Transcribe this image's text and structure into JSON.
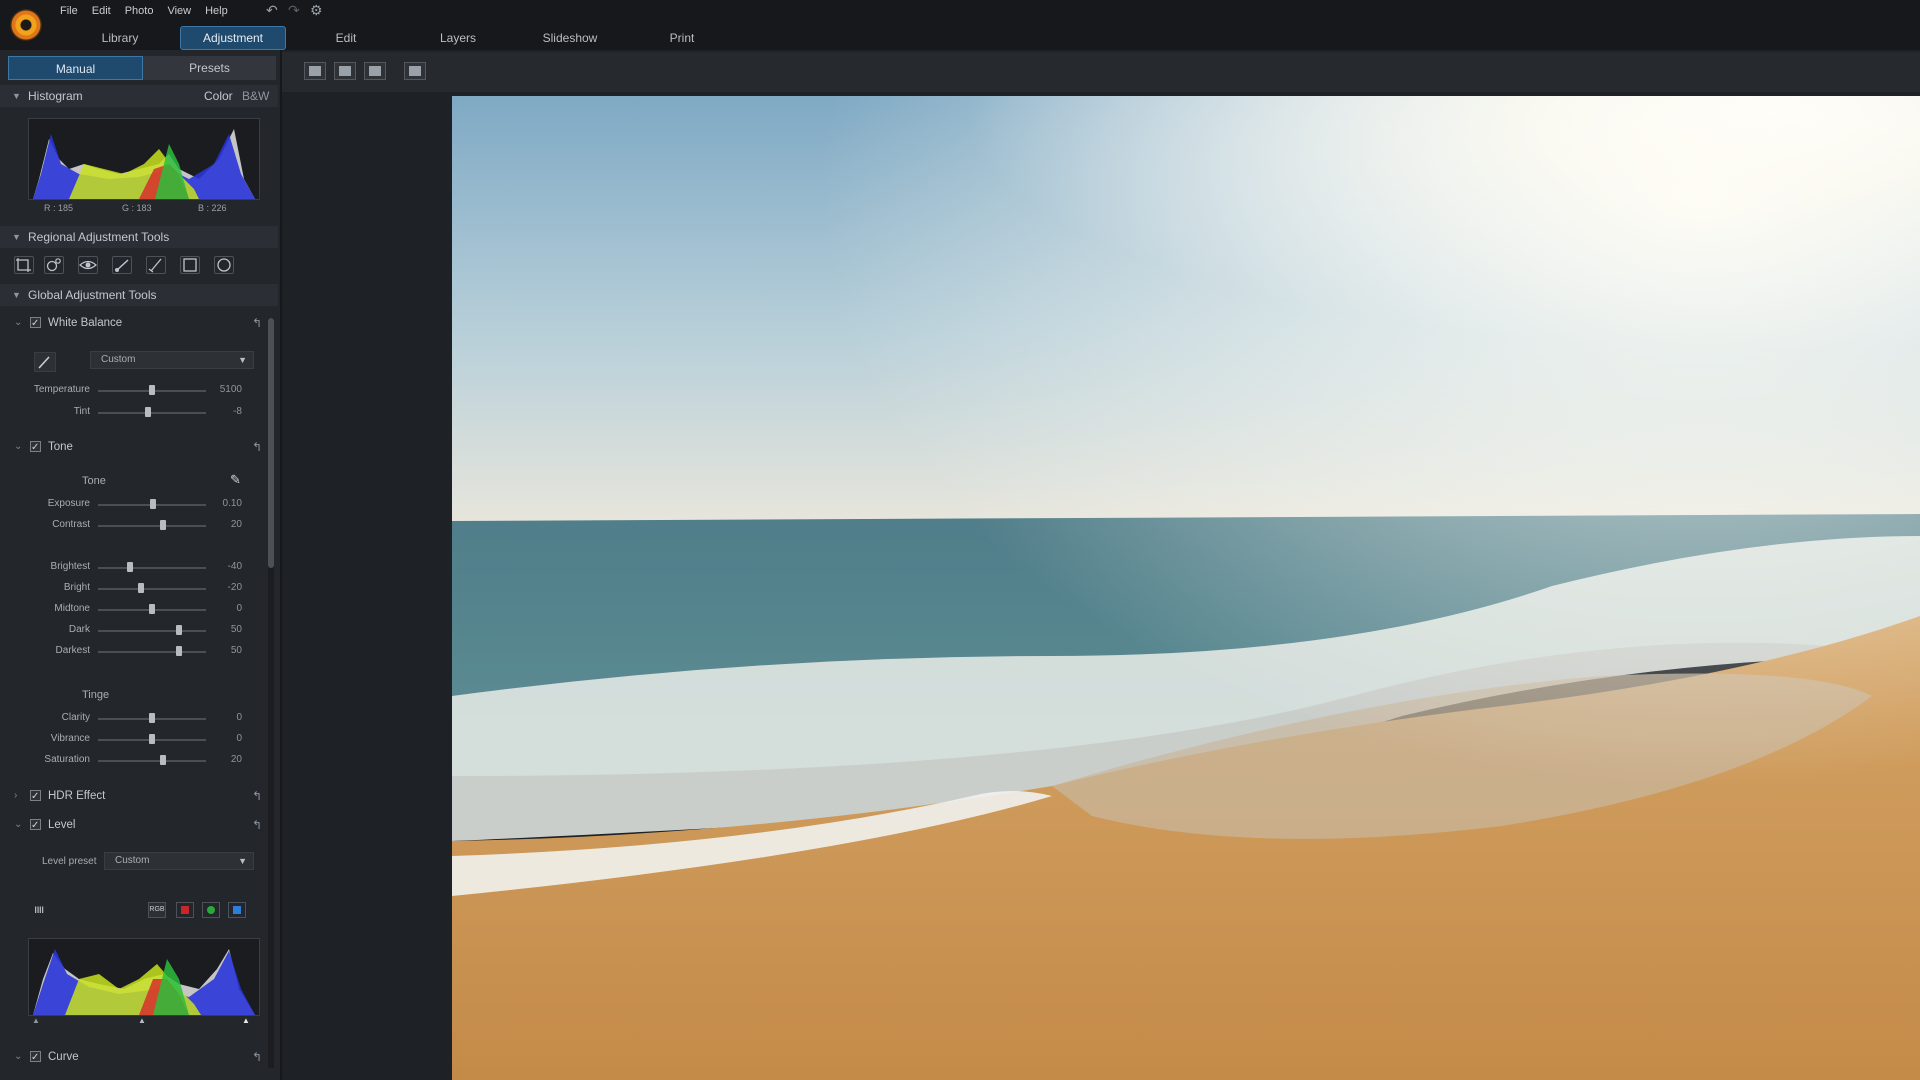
{
  "menu": [
    "File",
    "Edit",
    "Photo",
    "View",
    "Help"
  ],
  "main_tabs": [
    "Library",
    "Adjustment",
    "Edit",
    "Layers",
    "Slideshow",
    "Print"
  ],
  "mode_tabs": [
    "Manual",
    "Presets"
  ],
  "histogram": {
    "title": "Histogram",
    "color_label": "Color",
    "bw_label": "B&W",
    "r": "R : 185",
    "g": "G : 183",
    "b": "B : 226"
  },
  "regional": {
    "title": "Regional Adjustment Tools"
  },
  "global": {
    "title": "Global Adjustment Tools"
  },
  "white_balance": {
    "title": "White Balance",
    "preset": "Custom",
    "sliders": [
      {
        "label": "Temperature",
        "value": "5100",
        "pos": 0.5
      },
      {
        "label": "Tint",
        "value": "-8",
        "pos": 0.46
      }
    ]
  },
  "tone": {
    "title": "Tone",
    "sub": "Tone",
    "sliders": [
      {
        "label": "Exposure",
        "value": "0.10",
        "pos": 0.51
      },
      {
        "label": "Contrast",
        "value": "20",
        "pos": 0.6
      },
      {
        "label": "Brightest",
        "value": "-40",
        "pos": 0.3
      },
      {
        "label": "Bright",
        "value": "-20",
        "pos": 0.4
      },
      {
        "label": "Midtone",
        "value": "0",
        "pos": 0.5
      },
      {
        "label": "Dark",
        "value": "50",
        "pos": 0.75
      },
      {
        "label": "Darkest",
        "value": "50",
        "pos": 0.75
      }
    ],
    "tinge": "Tinge",
    "tinge_sliders": [
      {
        "label": "Clarity",
        "value": "0",
        "pos": 0.5
      },
      {
        "label": "Vibrance",
        "value": "0",
        "pos": 0.5
      },
      {
        "label": "Saturation",
        "value": "20",
        "pos": 0.6
      }
    ]
  },
  "hdr": {
    "title": "HDR Effect"
  },
  "level": {
    "title": "Level",
    "preset_label": "Level preset",
    "preset": "Custom",
    "rgb_label": "RGB"
  },
  "curve": {
    "title": "Curve"
  }
}
